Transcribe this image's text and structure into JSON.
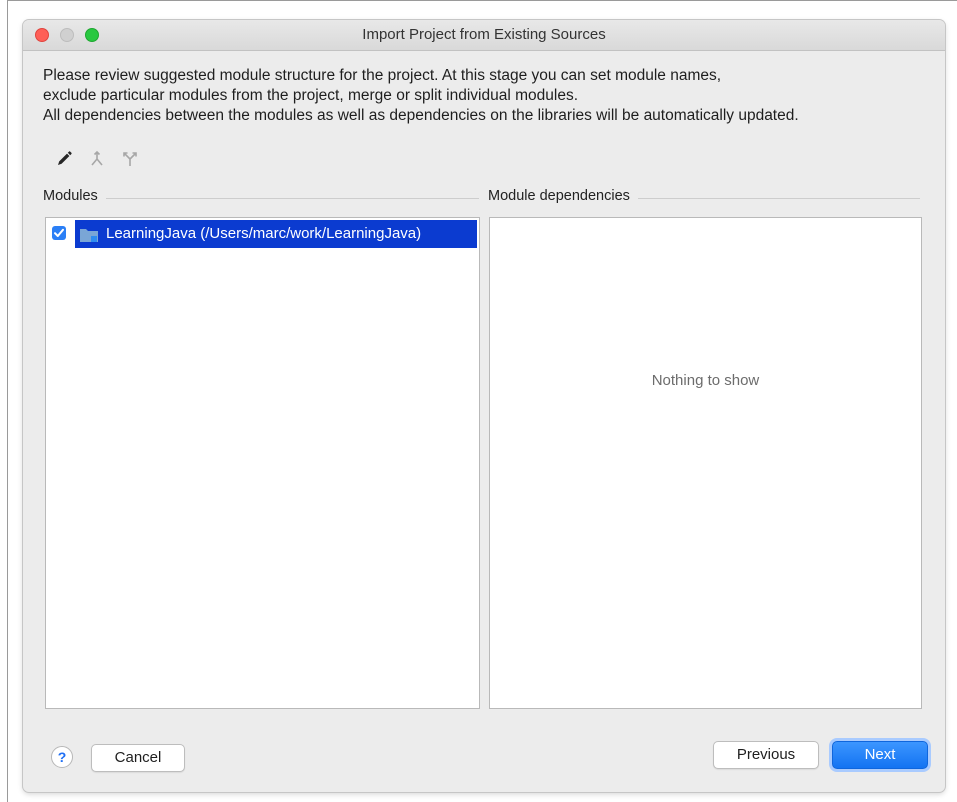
{
  "window": {
    "title": "Import Project from Existing Sources"
  },
  "description": {
    "line1": "Please review suggested module structure for the project. At this stage you can set module names,",
    "line2": "exclude particular modules from the project, merge or split individual modules.",
    "line3": "All dependencies between the modules as well as dependencies on the libraries will be automatically updated."
  },
  "toolbar": {
    "icons": [
      "pencil-icon",
      "merge-icon",
      "split-icon"
    ]
  },
  "modules": {
    "label": "Modules",
    "items": [
      {
        "label": "LearningJava (/Users/marc/work/LearningJava)",
        "checked": true
      }
    ]
  },
  "dependencies": {
    "label": "Module dependencies",
    "empty_text": "Nothing to show"
  },
  "footer": {
    "help_label": "?",
    "cancel_label": "Cancel",
    "previous_label": "Previous",
    "next_label": "Next"
  },
  "colors": {
    "selection": "#0b3bd0",
    "accent": "#1373f2"
  }
}
